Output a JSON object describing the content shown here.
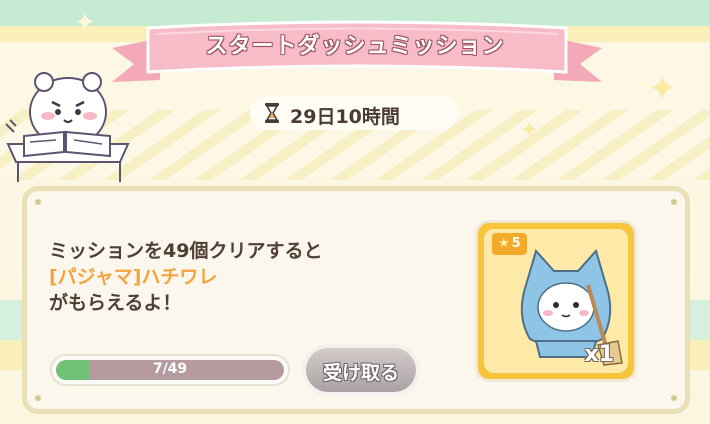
{
  "header": {
    "title": "スタートダッシュミッション"
  },
  "timer": {
    "icon": "hourglass-icon",
    "remaining": "29日10時間"
  },
  "mission": {
    "line1": "ミッションを49個クリアすると",
    "line2": "[パジャマ]ハチワレ",
    "line3": "がもらえるよ！"
  },
  "progress": {
    "current": 7,
    "total": 49,
    "label": "7/49"
  },
  "claim_button": {
    "label": "受け取る",
    "enabled": false
  },
  "reward": {
    "rarity": "5",
    "quantity": "x1",
    "item_icon": "hachiware-pajama-icon"
  },
  "colors": {
    "accent_text": "#f3a33f",
    "progress_fill": "#6fc277",
    "ribbon": "#f5b5c1",
    "card_frame": "#f6c53c"
  }
}
